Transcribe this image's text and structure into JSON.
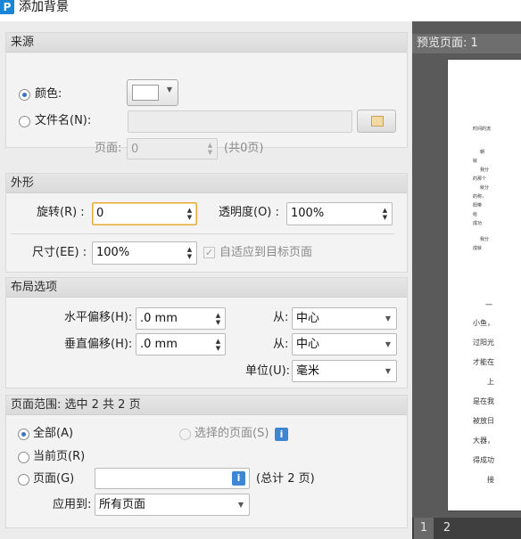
{
  "window": {
    "title": "添加背景",
    "app_icon": "P"
  },
  "source": {
    "header": "来源",
    "color_label": "颜色:",
    "file_label": "文件名(N):",
    "page_label": "页面:",
    "page_value": "0",
    "page_total": "(共0页)",
    "swatch_color": "#ffffff"
  },
  "appearance": {
    "header": "外形",
    "rotate_label": "旋转(R) :",
    "rotate_value": "0",
    "opacity_label": "透明度(O) :",
    "opacity_value": "100%",
    "size_label": "尺寸(EE) :",
    "size_value": "100%",
    "fit_label": "自适应到目标页面"
  },
  "layout": {
    "header": "布局选项",
    "h_offset_label": "水平偏移(H):",
    "h_offset_value": ".0 mm",
    "v_offset_label": "垂直偏移(H):",
    "v_offset_value": ".0 mm",
    "from_label": "从:",
    "h_from_value": "中心",
    "v_from_value": "中心",
    "unit_label": "单位(U):",
    "unit_value": "毫米"
  },
  "page_range": {
    "header": "页面范围: 选中 2 共 2 页",
    "all_label": "全部(A)",
    "selected_label": "选择的页面(S)",
    "current_label": "当前页(R)",
    "pages_label": "页面(G)",
    "pages_total": "(总计 2 页)",
    "apply_label": "应用到:",
    "apply_value": "所有页面",
    "info_glyph": "i"
  },
  "preview": {
    "header": "预览页面: 1",
    "pages": [
      "1",
      "2"
    ],
    "text_lines": [
      "时间的流",
      "朝",
      "就",
      "我分",
      "的那个",
      "就分",
      "的称，",
      "阳带",
      "给",
      "成功",
      "在",
      "并",
      "",
      "我分",
      "成就",
      "",
      "一",
      "小鱼，",
      "过阳光",
      "才能在",
      "上",
      "是在我",
      "被放日",
      "大器，",
      "得成功",
      "接"
    ]
  }
}
